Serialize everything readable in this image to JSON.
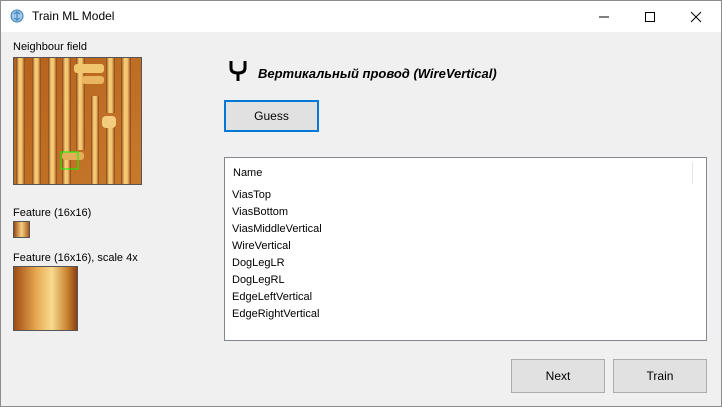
{
  "window": {
    "title": "Train ML Model"
  },
  "left": {
    "neighbour_label": "Neighbour field",
    "feature_label": "Feature (16x16)",
    "feature_scaled_label": "Feature (16x16), scale 4x"
  },
  "main": {
    "heading_icon": "fork-cell-icon",
    "heading": "Вертикальный провод (WireVertical)",
    "guess_label": "Guess",
    "list": {
      "column_header": "Name",
      "items": [
        "ViasTop",
        "ViasBottom",
        "ViasMiddleVertical",
        "WireVertical",
        "DogLegLR",
        "DogLegRL",
        "EdgeLeftVertical",
        "EdgeRightVertical"
      ]
    },
    "next_label": "Next",
    "train_label": "Train"
  },
  "colors": {
    "accent": "#0078d7",
    "selection_marker": "#00ff00"
  }
}
